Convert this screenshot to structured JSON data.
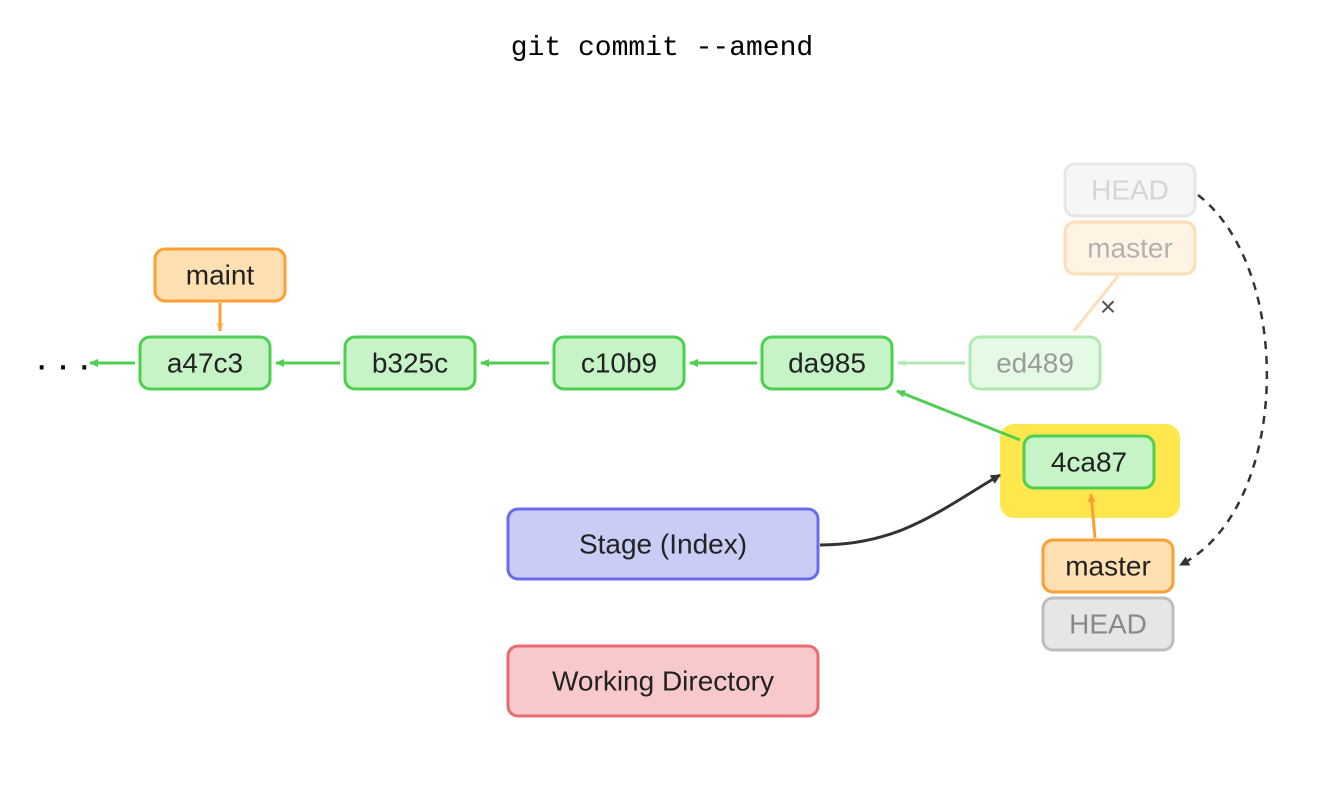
{
  "title": "git commit --amend",
  "commits": [
    "a47c3",
    "b325c",
    "c10b9",
    "da985",
    "ed489"
  ],
  "newCommit": "4ca87",
  "branches": {
    "maint": "maint",
    "master_old": "master",
    "master_new": "master"
  },
  "heads": {
    "old": "HEAD",
    "new": "HEAD"
  },
  "stage": "Stage (Index)",
  "workingDir": "Working Directory",
  "ellipsis": "···",
  "xMark": "×"
}
